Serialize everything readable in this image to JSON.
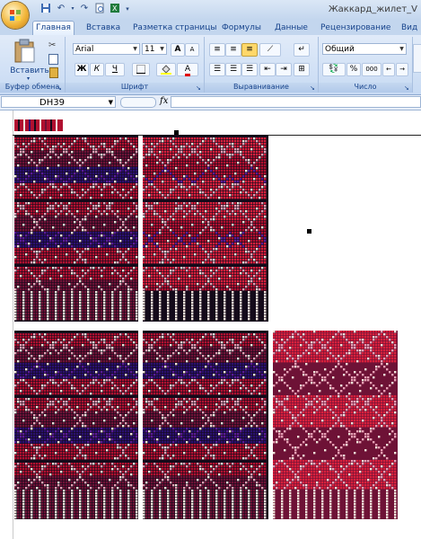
{
  "window": {
    "title": "Жаккард_жилет_V"
  },
  "tabs": [
    {
      "label": "Главная",
      "active": true
    },
    {
      "label": "Вставка",
      "active": false
    },
    {
      "label": "Разметка страницы",
      "active": false
    },
    {
      "label": "Формулы",
      "active": false
    },
    {
      "label": "Данные",
      "active": false
    },
    {
      "label": "Рецензирование",
      "active": false
    },
    {
      "label": "Вид",
      "active": false
    }
  ],
  "ribbon": {
    "clipboard": {
      "paste_label": "Вставить",
      "group_label": "Буфер обмена"
    },
    "font": {
      "font_name": "Arial",
      "font_size": "11",
      "bold": "Ж",
      "italic": "К",
      "underline": "Ч",
      "grow": "A",
      "shrink": "A",
      "group_label": "Шрифт"
    },
    "alignment": {
      "group_label": "Выравнивание"
    },
    "number": {
      "format": "Общий",
      "percent": "%",
      "thousands": "000",
      "group_label": "Число"
    }
  },
  "formula_bar": {
    "cell_ref": "DH39",
    "fx": "fx",
    "value": ""
  },
  "colors": {
    "ribbon_bg": "#dbe7f6",
    "dark": "#140a1a",
    "crimson": "#b01030",
    "red": "#d8203c",
    "maroon": "#6e1236",
    "navy": "#2a1070",
    "purple": "#5a1b9a",
    "cream": "#efe4da",
    "pink": "#e6a0b4"
  }
}
